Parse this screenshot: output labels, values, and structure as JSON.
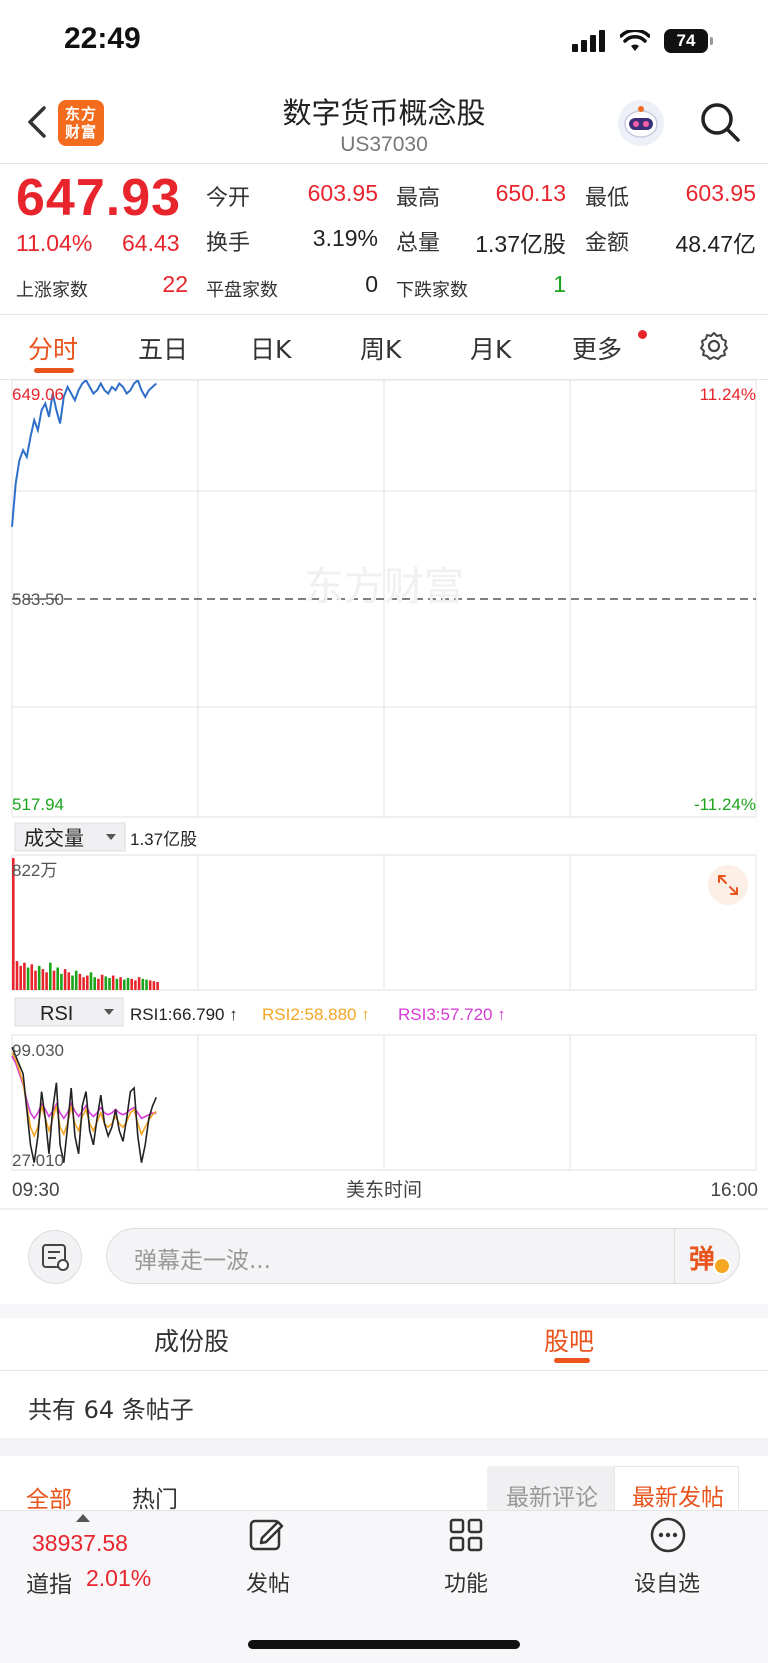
{
  "status": {
    "time": "22:49",
    "battery": "74"
  },
  "header": {
    "title": "数字货币概念股",
    "code": "US37030",
    "logo_text_1": "东方",
    "logo_text_2": "财富"
  },
  "quote": {
    "price": "647.93",
    "change_pct": "11.04%",
    "change_amt": "64.43",
    "open_label": "今开",
    "open": "603.95",
    "high_label": "最高",
    "high": "650.13",
    "low_label": "最低",
    "low": "603.95",
    "turnover_label": "换手",
    "turnover": "3.19%",
    "volume_label": "总量",
    "volume": "1.37亿股",
    "amount_label": "金额",
    "amount": "48.47亿",
    "up_label": "上涨家数",
    "up": "22",
    "flat_label": "平盘家数",
    "flat": "0",
    "down_label": "下跌家数",
    "down": "1"
  },
  "tabs": [
    "分时",
    "五日",
    "日K",
    "周K",
    "月K",
    "更多"
  ],
  "chart": {
    "max_price": "649.06",
    "mid_price": "583.50",
    "min_price": "517.94",
    "max_pct": "11.24%",
    "min_pct": "-11.24%",
    "watermark": "东方财富",
    "volume_selector": "成交量",
    "volume_total": "1.37亿股",
    "volume_max": "822万",
    "rsi_selector": "RSI",
    "rsi1": "RSI1:66.790 ↑",
    "rsi2": "RSI2:58.880 ↑",
    "rsi3": "RSI3:57.720 ↑",
    "rsi_max": "99.030",
    "rsi_min": "27.010",
    "time_start": "09:30",
    "time_mid": "美东时间",
    "time_end": "16:00",
    "colors": {
      "price_line": "#2f6fc9",
      "up": "#e8242c",
      "down": "#1ca51c",
      "rsi1": "#222222",
      "rsi2": "#f5a623",
      "rsi3": "#d63ad6"
    }
  },
  "chart_data": {
    "type": "line",
    "title": "",
    "x_range": [
      "09:30",
      "16:00"
    ],
    "ylim": [
      517.94,
      649.06
    ],
    "reference": 583.5,
    "price_series": [
      605,
      618,
      625,
      628,
      626,
      632,
      637,
      634,
      640,
      642,
      638,
      645,
      640,
      636,
      644,
      647,
      645,
      643,
      646,
      648,
      649,
      647,
      645,
      646,
      648,
      646,
      645,
      647,
      646,
      648,
      647,
      645,
      646,
      648,
      649,
      646,
      644,
      646,
      647,
      648
    ],
    "volume_series": [
      822,
      180,
      150,
      170,
      140,
      160,
      120,
      150,
      130,
      110,
      170,
      120,
      140,
      100,
      130,
      110,
      90,
      120,
      100,
      80,
      90,
      110,
      80,
      70,
      95,
      85,
      75,
      90,
      70,
      80,
      65,
      75,
      70,
      60,
      80,
      70,
      65,
      60,
      55,
      50
    ],
    "rsi_range": [
      27.01,
      99.03
    ],
    "rsi1_series": [
      95,
      90,
      85,
      80,
      60,
      40,
      30,
      45,
      70,
      55,
      35,
      60,
      75,
      40,
      30,
      50,
      72,
      45,
      35,
      62,
      70,
      48,
      40,
      55,
      68,
      52,
      45,
      50,
      60,
      48,
      42,
      55,
      70,
      72,
      45,
      30,
      40,
      55,
      62,
      66.79
    ],
    "rsi2_series": [
      92,
      88,
      82,
      75,
      62,
      50,
      45,
      50,
      62,
      55,
      48,
      55,
      62,
      50,
      46,
      52,
      62,
      52,
      48,
      56,
      60,
      52,
      48,
      53,
      58,
      52,
      50,
      52,
      56,
      52,
      50,
      53,
      58,
      60,
      52,
      46,
      50,
      54,
      57,
      58.88
    ],
    "rsi3_series": [
      90,
      86,
      80,
      74,
      65,
      58,
      55,
      58,
      63,
      60,
      56,
      59,
      63,
      58,
      55,
      58,
      63,
      59,
      56,
      59,
      62,
      58,
      56,
      58,
      61,
      58,
      57,
      58,
      60,
      58,
      57,
      58,
      60,
      61,
      58,
      55,
      56,
      57,
      58,
      57.72
    ]
  },
  "comment": {
    "placeholder": "弹幕走一波...",
    "send_label": "弹"
  },
  "segments": {
    "constituents": "成份股",
    "forum": "股吧"
  },
  "posts": {
    "count_text": "共有 64 条帖子"
  },
  "sub_tabs": {
    "all": "全部",
    "hot": "热门",
    "latest_comment": "最新评论",
    "latest_post": "最新发帖"
  },
  "bottom": {
    "index_value": "38937.58",
    "index_name": "道指",
    "index_change": "2.01%",
    "post_label": "发帖",
    "func_label": "功能",
    "watch_label": "设自选"
  }
}
